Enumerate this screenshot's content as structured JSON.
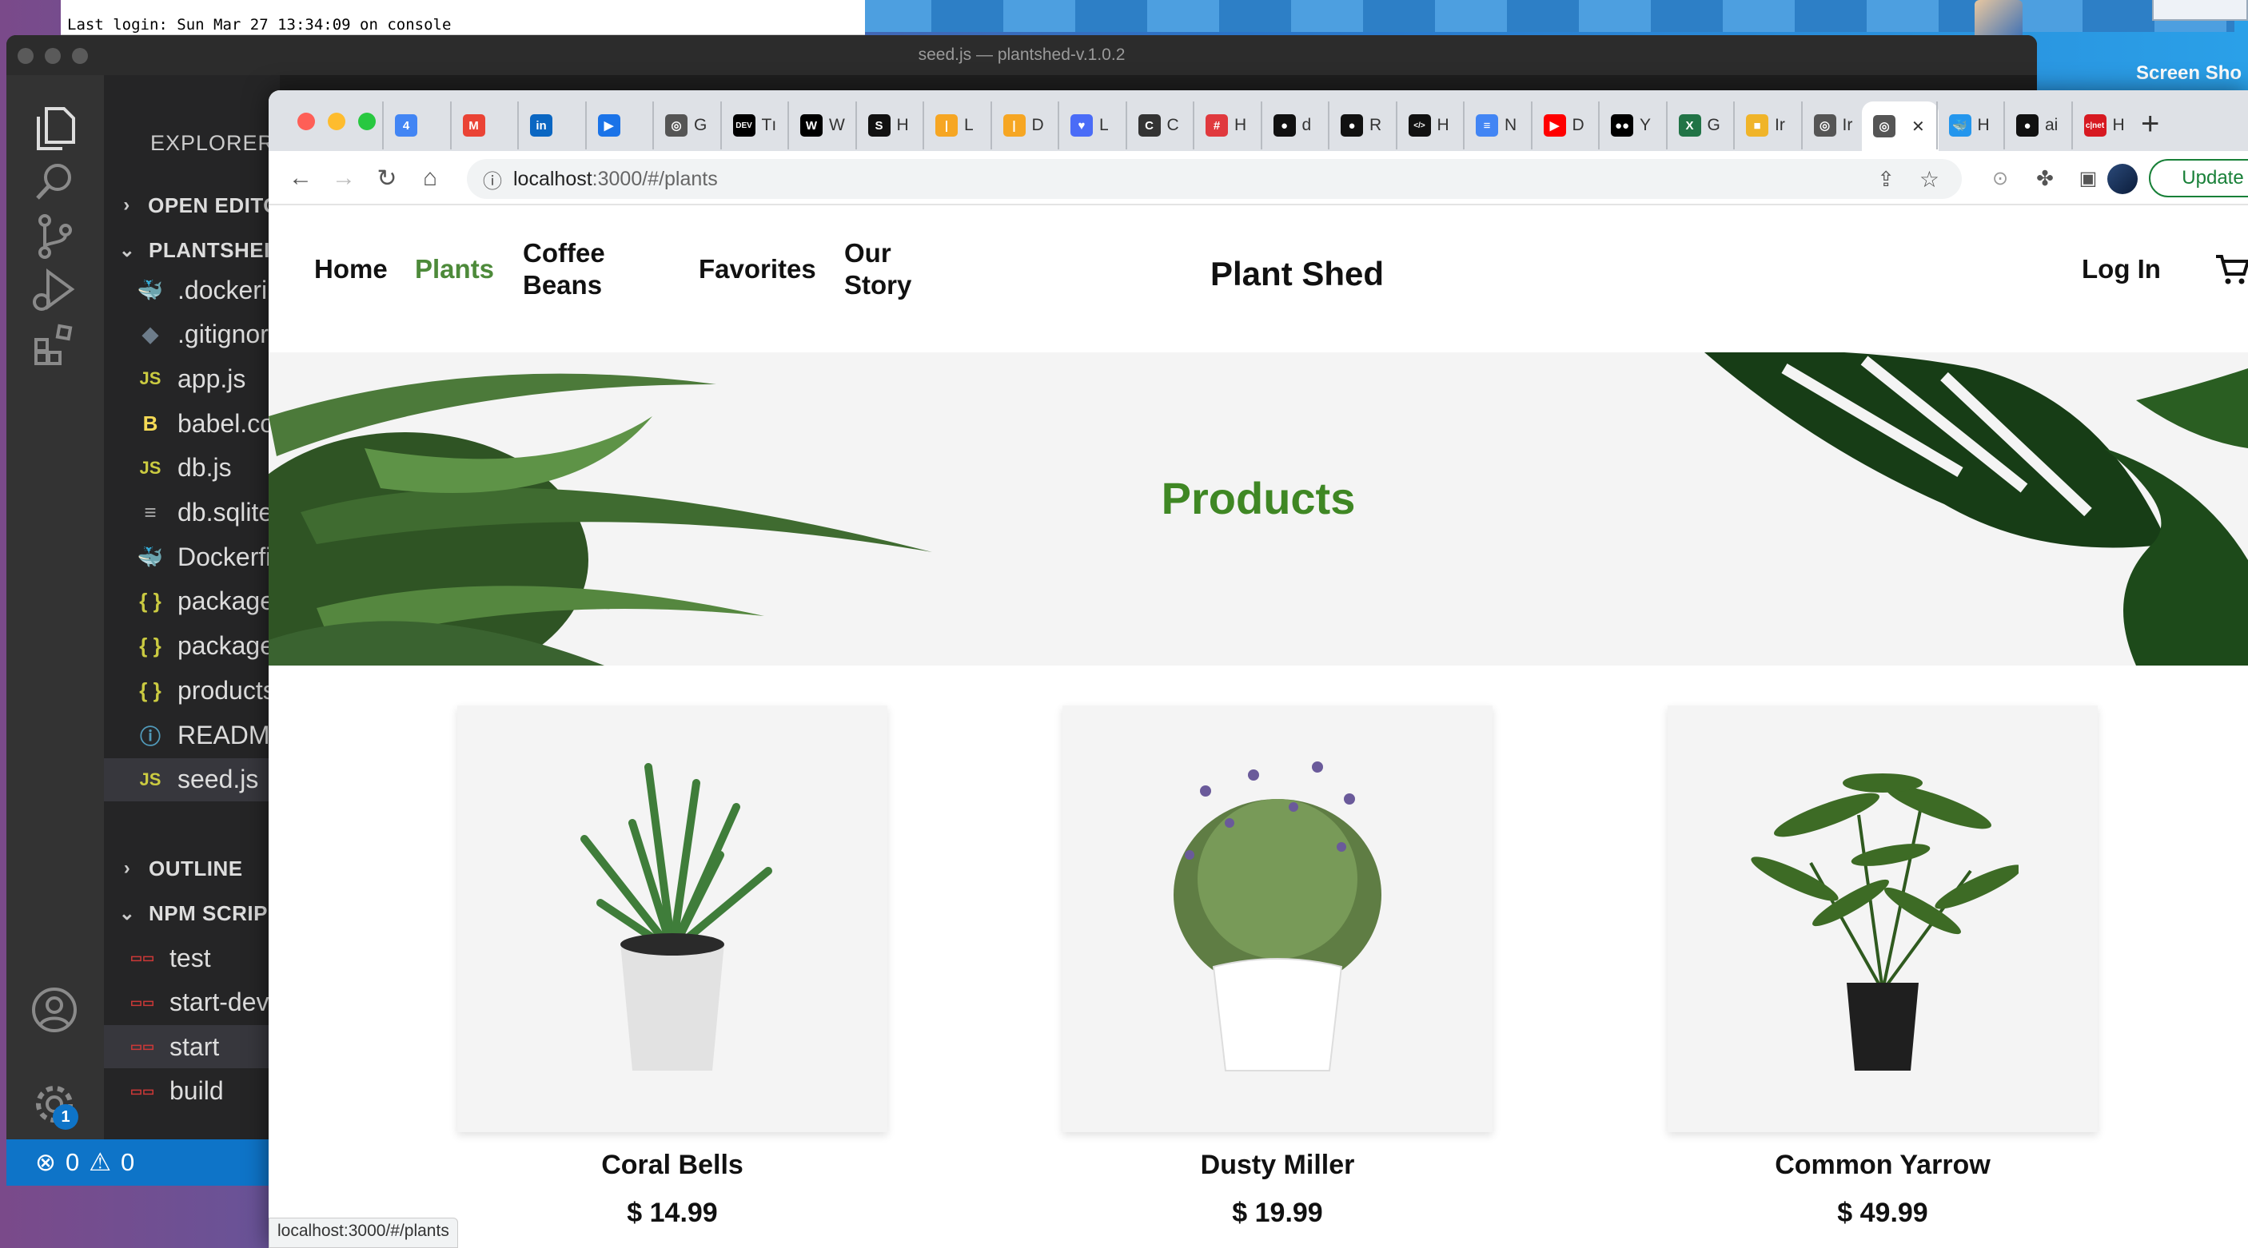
{
  "terminal": {
    "text": "Last login: Sun Mar 27 13:34:09 on console"
  },
  "desktop": {
    "screenshot_label": "Screen Sho"
  },
  "vscode": {
    "title": "seed.js — plantshed-v.1.0.2",
    "explorer_label": "EXPLORER",
    "settings_badge": "1",
    "sections": {
      "open_editors": "OPEN EDITO",
      "project": "PLANTSHEI",
      "outline": "OUTLINE",
      "npm_scripts": "NPM SCRIP"
    },
    "files": [
      {
        "icon": "docker-icon",
        "glyph": "🐳",
        "color": "#5b8fb9",
        "label": ".dockeri"
      },
      {
        "icon": "git-icon",
        "glyph": "◆",
        "color": "#6d7c8a",
        "label": ".gitignor"
      },
      {
        "icon": "js-icon",
        "glyph": "JS",
        "color": "#cbcb41",
        "label": "app.js"
      },
      {
        "icon": "babel-icon",
        "glyph": "B",
        "color": "#f5da55",
        "label": "babel.co"
      },
      {
        "icon": "js-icon",
        "glyph": "JS",
        "color": "#cbcb41",
        "label": "db.js"
      },
      {
        "icon": "file-lines-icon",
        "glyph": "≡",
        "color": "#aaaaaa",
        "label": "db.sqlite"
      },
      {
        "icon": "docker-icon",
        "glyph": "🐳",
        "color": "#5b8fb9",
        "label": "Dockerfi"
      },
      {
        "icon": "json-icon",
        "glyph": "{ }",
        "color": "#cbcb41",
        "label": "package"
      },
      {
        "icon": "json-icon",
        "glyph": "{ }",
        "color": "#cbcb41",
        "label": "package"
      },
      {
        "icon": "json-icon",
        "glyph": "{ }",
        "color": "#cbcb41",
        "label": "products"
      },
      {
        "icon": "info-icon",
        "glyph": "ⓘ",
        "color": "#519aba",
        "label": "READMI"
      },
      {
        "icon": "js-icon",
        "glyph": "JS",
        "color": "#cbcb41",
        "label": "seed.js"
      }
    ],
    "scripts": [
      {
        "icon": "npm-icon",
        "label": "test"
      },
      {
        "icon": "npm-icon",
        "label": "start-dev"
      },
      {
        "icon": "npm-icon",
        "label": "start"
      },
      {
        "icon": "npm-icon",
        "label": "build"
      }
    ],
    "status": {
      "errors": "0",
      "warnings": "0"
    }
  },
  "browser": {
    "tabs": [
      {
        "icon": "google-calendar-icon",
        "fav": "4",
        "color": "#4285f4",
        "label": ""
      },
      {
        "icon": "gmail-icon",
        "fav": "M",
        "color": "#ea4335",
        "label": ""
      },
      {
        "icon": "linkedin-icon",
        "fav": "in",
        "color": "#0a66c2",
        "label": ""
      },
      {
        "icon": "video-icon",
        "fav": "▶",
        "color": "#1a73e8",
        "label": ""
      },
      {
        "icon": "globe-icon",
        "fav": "◎",
        "color": "#555555",
        "label": "G"
      },
      {
        "icon": "dev-icon",
        "fav": "DEV",
        "color": "#000000",
        "label": "Tı"
      },
      {
        "icon": "www-icon",
        "fav": "W",
        "color": "#000000",
        "label": "W"
      },
      {
        "icon": "s-icon",
        "fav": "S",
        "color": "#111111",
        "label": "H"
      },
      {
        "icon": "bars-icon",
        "fav": "|",
        "color": "#f6a623",
        "label": "L"
      },
      {
        "icon": "bars-icon",
        "fav": "|",
        "color": "#f6a623",
        "label": "D"
      },
      {
        "icon": "heart-icon",
        "fav": "♥",
        "color": "#4a6cf7",
        "label": "L"
      },
      {
        "icon": "c-icon",
        "fav": "C",
        "color": "#333333",
        "label": "C"
      },
      {
        "icon": "grid-icon",
        "fav": "#",
        "color": "#e0393e",
        "label": "H"
      },
      {
        "icon": "github-icon",
        "fav": "●",
        "color": "#111111",
        "label": "d"
      },
      {
        "icon": "github-icon",
        "fav": "●",
        "color": "#111111",
        "label": "R"
      },
      {
        "icon": "code-icon",
        "fav": "</>",
        "color": "#111111",
        "label": "H"
      },
      {
        "icon": "docs-icon",
        "fav": "≡",
        "color": "#4285f4",
        "label": "N"
      },
      {
        "icon": "youtube-icon",
        "fav": "▶",
        "color": "#ff0000",
        "label": "D"
      },
      {
        "icon": "medium-icon",
        "fav": "●●",
        "color": "#000000",
        "label": "Y"
      },
      {
        "icon": "excel-icon",
        "fav": "X",
        "color": "#217346",
        "label": "G"
      },
      {
        "icon": "box-icon",
        "fav": "■",
        "color": "#f0b429",
        "label": "Ir"
      },
      {
        "icon": "globe-icon",
        "fav": "◎",
        "color": "#555555",
        "label": "Ir"
      },
      {
        "icon": "globe-icon",
        "fav": "◎",
        "color": "#555555",
        "label": ""
      },
      {
        "icon": "docker-icon",
        "fav": "🐳",
        "color": "#2496ed",
        "label": "H"
      },
      {
        "icon": "github-icon",
        "fav": "●",
        "color": "#111111",
        "label": "ai"
      },
      {
        "icon": "cnet-icon",
        "fav": "c|net",
        "color": "#d71921",
        "label": "H"
      }
    ],
    "url_host": "localhost",
    "url_path": ":3000/#/plants",
    "update_label": "Update",
    "status_url": "localhost:3000/#/plants"
  },
  "site": {
    "nav": {
      "home": "Home",
      "plants": "Plants",
      "coffee_beans": "Coffee Beans",
      "favorites": "Favorites",
      "our_story": "Our Story",
      "login": "Log In"
    },
    "brand": "Plant Shed",
    "hero_title": "Products",
    "accent_color": "#3f8724",
    "products": [
      {
        "name": "Coral Bells",
        "price": "$ 14.99"
      },
      {
        "name": "Dusty Miller",
        "price": "$ 19.99"
      },
      {
        "name": "Common Yarrow",
        "price": "$ 49.99"
      }
    ]
  }
}
